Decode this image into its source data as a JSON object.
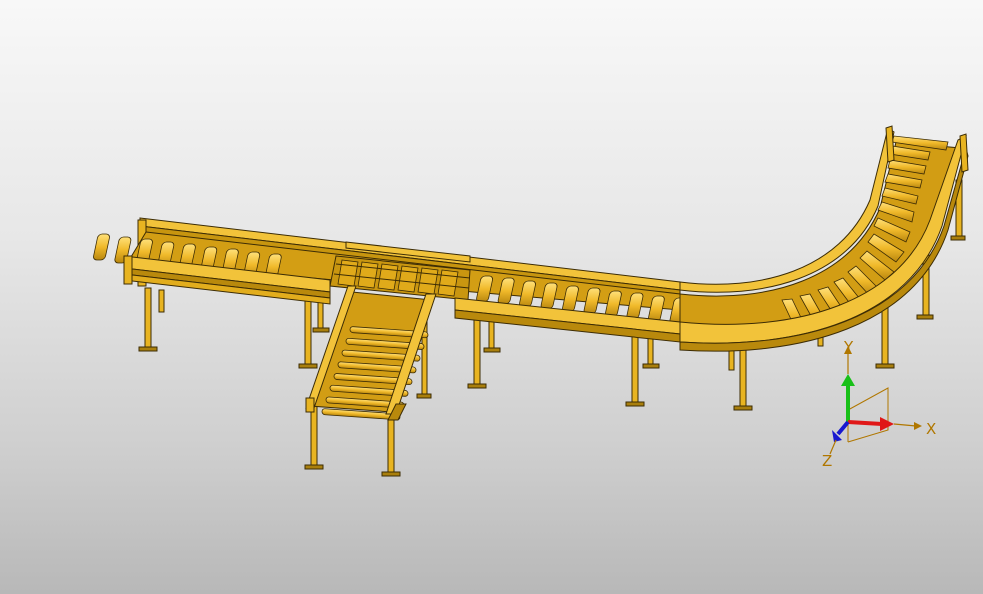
{
  "colors": {
    "model": "#e8b421",
    "model_light": "#f6cb3e",
    "model_dark": "#a97f0d",
    "edge": "#3c2c05",
    "axis_x": "#e01818",
    "axis_y": "#18c018",
    "axis_z": "#1818d0",
    "axis_label": "#b07700"
  },
  "viewport": {
    "model_name": "roller-conveyor-assembly",
    "triad": {
      "x_label": "X",
      "y_label": "Y",
      "z_label": "Z"
    }
  }
}
